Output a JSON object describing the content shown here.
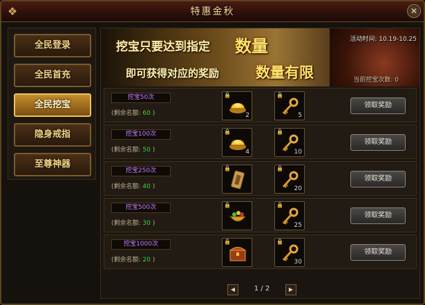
{
  "window": {
    "title": "特惠金秋",
    "close_glyph": "✕"
  },
  "sidebar": {
    "items": [
      {
        "label": "全民登录",
        "active": false
      },
      {
        "label": "全民首充",
        "active": false
      },
      {
        "label": "全民挖宝",
        "active": true
      },
      {
        "label": "隐身戒指",
        "active": false
      },
      {
        "label": "至尊神器",
        "active": false
      }
    ]
  },
  "banner": {
    "line1": "挖宝只要达到指定",
    "highlight1": "数量",
    "line2": "即可获得对应的奖励",
    "highlight2": "数量有限",
    "time": "活动时间: 10.19-10.25",
    "count": "当前挖宝次数: 0"
  },
  "rows": [
    {
      "tier": "挖宝50次",
      "remain_label": "(剩余名额:",
      "remain_num": "60",
      "remain_close": ")",
      "item1_icon": "gold-ingot-icon",
      "item1_qty": "2",
      "item2_icon": "golden-key-icon",
      "item2_qty": "5",
      "claim": "领取奖励"
    },
    {
      "tier": "挖宝100次",
      "remain_label": "(剩余名额:",
      "remain_num": "50",
      "remain_close": ")",
      "item1_icon": "gold-ingot-icon",
      "item1_qty": "4",
      "item2_icon": "golden-key-icon",
      "item2_qty": "10",
      "claim": "领取奖励"
    },
    {
      "tier": "挖宝250次",
      "remain_label": "(剩余名额:",
      "remain_num": "40",
      "remain_close": ")",
      "item1_icon": "scroll-talisman-icon",
      "item1_qty": "",
      "item2_icon": "golden-key-icon",
      "item2_qty": "20",
      "claim": "领取奖励"
    },
    {
      "tier": "挖宝500次",
      "remain_label": "(剩余名额:",
      "remain_num": "30",
      "remain_close": ")",
      "item1_icon": "treasure-bowl-icon",
      "item1_qty": "",
      "item2_icon": "golden-key-icon",
      "item2_qty": "25",
      "claim": "领取奖励"
    },
    {
      "tier": "挖宝1000次",
      "remain_label": "(剩余名额:",
      "remain_num": "20",
      "remain_close": ")",
      "item1_icon": "treasure-chest-icon",
      "item1_qty": "",
      "item2_icon": "golden-key-icon",
      "item2_qty": "30",
      "claim": "领取奖励"
    }
  ],
  "pager": {
    "prev": "◀",
    "text": "1 / 2",
    "next": "▶"
  }
}
